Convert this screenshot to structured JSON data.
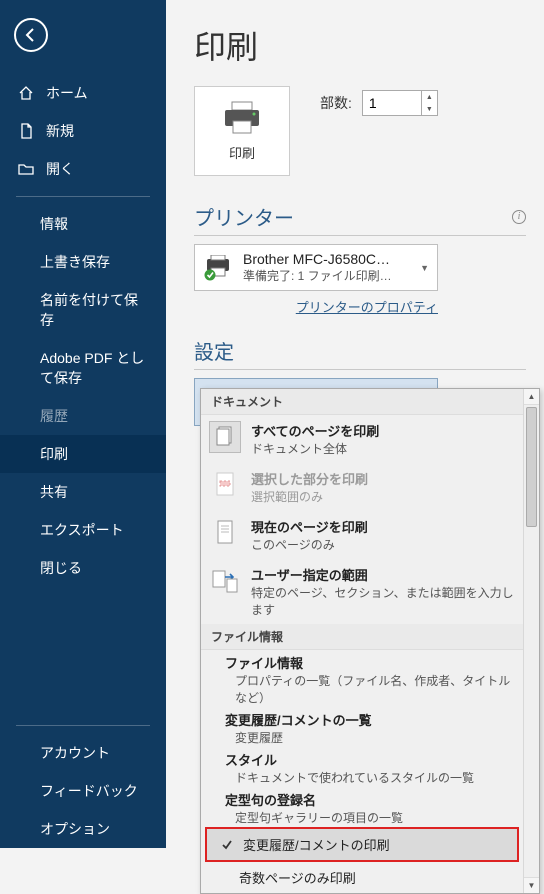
{
  "page_title": "印刷",
  "sidebar": {
    "home": "ホーム",
    "new": "新規",
    "open": "開く",
    "info": "情報",
    "save": "上書き保存",
    "saveas": "名前を付けて保存",
    "adobe": "Adobe PDF として保存",
    "history": "履歴",
    "print": "印刷",
    "share": "共有",
    "export": "エクスポート",
    "close": "閉じる",
    "account": "アカウント",
    "feedback": "フィードバック",
    "options": "オプション"
  },
  "print_tile_label": "印刷",
  "copies": {
    "label": "部数:",
    "value": "1"
  },
  "printer": {
    "heading": "プリンター",
    "name": "Brother MFC-J6580C…",
    "status": "準備完了: 1 ファイル印刷…",
    "props_link": "プリンターのプロパティ"
  },
  "settings": {
    "heading": "設定",
    "current": {
      "line1": "すべてのページを印刷",
      "line2": "ドキュメント全体"
    }
  },
  "dropdown": {
    "section_doc": "ドキュメント",
    "items": [
      {
        "line1": "すべてのページを印刷",
        "line2": "ドキュメント全体"
      },
      {
        "line1": "選択した部分を印刷",
        "line2": "選択範囲のみ",
        "disabled": true
      },
      {
        "line1": "現在のページを印刷",
        "line2": "このページのみ"
      },
      {
        "line1": "ユーザー指定の範囲",
        "line2": "特定のページ、セクション、または範囲を入力します"
      }
    ],
    "section_file": "ファイル情報",
    "file_items": [
      {
        "line1": "ファイル情報",
        "line2": "プロパティの一覧（ファイル名、作成者、タイトルなど）"
      },
      {
        "line1": "変更履歴/コメントの一覧",
        "line2": "変更履歴"
      },
      {
        "line1": "スタイル",
        "line2": "ドキュメントで使われているスタイルの一覧"
      },
      {
        "line1": "定型句の登録名",
        "line2": "定型句ギャラリーの項目の一覧"
      }
    ],
    "checked_item": "変更履歴/コメントの印刷",
    "odd_pages": "奇数ページのみ印刷"
  }
}
